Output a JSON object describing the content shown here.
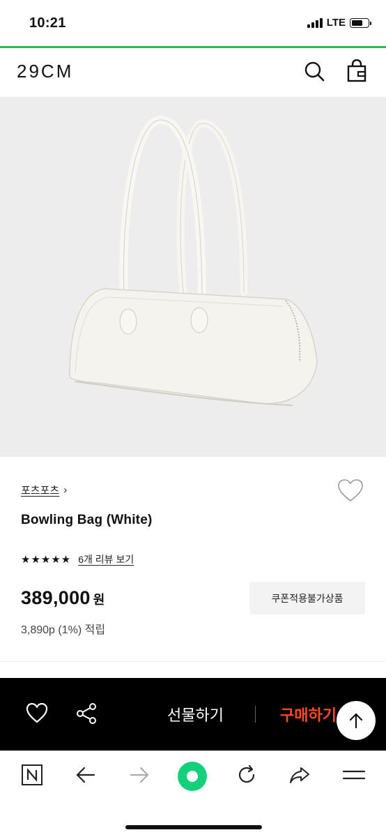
{
  "status_bar": {
    "time": "10:21",
    "network": "LTE",
    "battery_level": 0.7
  },
  "page_load_progress": 1.0,
  "header": {
    "logo": "29CM",
    "icons": [
      "search-icon",
      "shopping-bag-icon"
    ]
  },
  "product": {
    "image_icon": "white-bowling-bag-image",
    "brand": "포츠포츠",
    "brand_chevron": "›",
    "title": "Bowling Bag (White)",
    "stars": "★★★★★",
    "rating": 5,
    "review_link": "6개 리뷰 보기",
    "price": "389,000",
    "currency": "원",
    "coupon_label": "쿠폰적용불가상품",
    "points": "3,890p (1%) 적립"
  },
  "buy_bar": {
    "gift_label": "선물하기",
    "purchase_label": "구매하기",
    "icons": [
      "heart-icon",
      "share-icon",
      "arrow-up-icon"
    ]
  },
  "browser_bar": {
    "icons": [
      "naver-icon",
      "back-arrow-icon",
      "forward-arrow-icon",
      "green-dot-icon",
      "refresh-icon",
      "share-arrow-icon",
      "menu-icon"
    ]
  },
  "colors": {
    "accent_green": "#2dbd3c",
    "purchase_orange": "#ff4a1c",
    "buy_bar_bg": "#000000"
  }
}
